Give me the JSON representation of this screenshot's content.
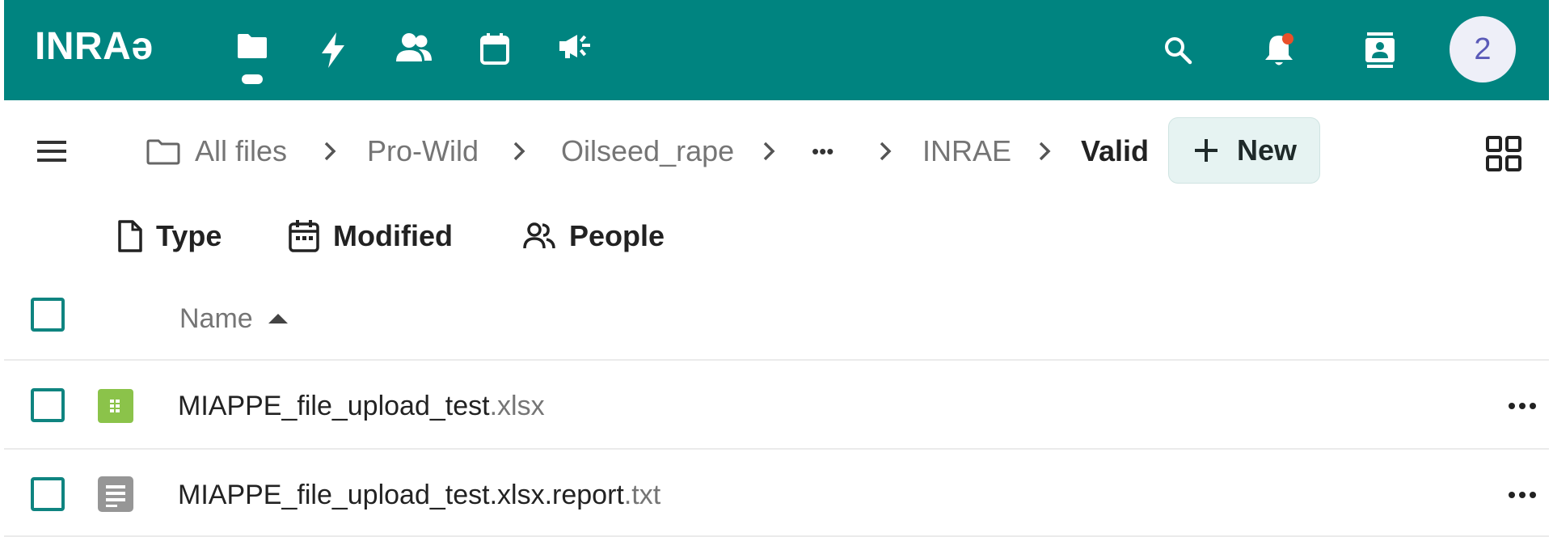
{
  "header": {
    "logo_text": "INRAə",
    "apps": [
      {
        "name": "Files",
        "icon": "folder-icon",
        "active": true
      },
      {
        "name": "Activity",
        "icon": "bolt-icon",
        "active": false
      },
      {
        "name": "Contacts",
        "icon": "people-icon",
        "active": false
      },
      {
        "name": "Calendar",
        "icon": "calendar-icon",
        "active": false
      },
      {
        "name": "Announcements",
        "icon": "megaphone-icon",
        "active": false
      }
    ],
    "right_icons": [
      "search-icon",
      "notification-bell-icon",
      "contacts-card-icon"
    ],
    "avatar_text": "2",
    "colors": {
      "bar": "#008480",
      "notification_dot": "#e9502a",
      "avatar_text": "#5a5ab8"
    }
  },
  "breadcrumb": {
    "root": "All files",
    "items": [
      "Pro-Wild",
      "Oilseed_rape",
      "•••",
      "INRAE"
    ],
    "current": "Valid"
  },
  "new_button": {
    "label": "New"
  },
  "filters": [
    {
      "label": "Type",
      "icon": "file-icon"
    },
    {
      "label": "Modified",
      "icon": "calendar-icon"
    },
    {
      "label": "People",
      "icon": "people-icon"
    }
  ],
  "table": {
    "column_name": "Name",
    "sort": "ascending",
    "files": [
      {
        "base": "MIAPPE_file_upload_test",
        "ext": ".xlsx",
        "icon": "spreadsheet-icon",
        "icon_color": "#8bc34a"
      },
      {
        "base": "MIAPPE_file_upload_test.xlsx.report",
        "ext": ".txt",
        "icon": "text-document-icon",
        "icon_color": "#969696"
      }
    ]
  },
  "accent_color": "#0f8480"
}
